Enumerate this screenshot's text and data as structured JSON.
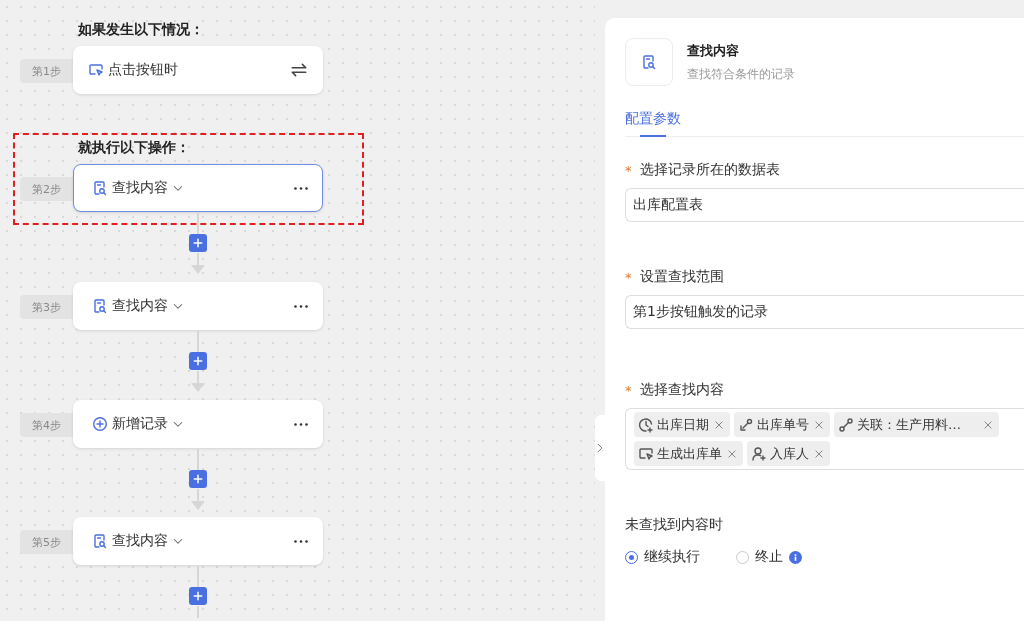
{
  "flow": {
    "trigger_heading": "如果发生以下情况：",
    "action_heading": "就执行以下操作：",
    "steps": [
      {
        "kind": "click",
        "step_label": "第1步",
        "title": "点击按钮时",
        "selected": false
      },
      {
        "kind": "find",
        "step_label": "第2步",
        "title": "查找内容",
        "selected": true
      },
      {
        "kind": "find",
        "step_label": "第3步",
        "title": "查找内容",
        "selected": false
      },
      {
        "kind": "add",
        "step_label": "第4步",
        "title": "新增记录",
        "selected": false
      },
      {
        "kind": "find",
        "step_label": "第5步",
        "title": "查找内容",
        "selected": false
      }
    ]
  },
  "panel": {
    "title": "查找内容",
    "subtitle": "查找符合条件的记录",
    "tabs": [
      {
        "label": "配置参数",
        "selected": true
      }
    ],
    "fields": [
      {
        "kind": "input",
        "required_mark": "*",
        "label": "选择记录所在的数据表",
        "value": "出库配置表"
      },
      {
        "kind": "input",
        "required_mark": "*",
        "label": "设置查找范围",
        "value": "第1步按钮触发的记录"
      },
      {
        "kind": "tags",
        "required_mark": "*",
        "label": "选择查找内容",
        "tags": [
          {
            "kind": "date",
            "label": "出库日期"
          },
          {
            "kind": "link",
            "label": "出库单号"
          },
          {
            "kind": "relation",
            "label": "关联：生产用料…"
          },
          {
            "kind": "click",
            "label": "生成出库单"
          },
          {
            "kind": "user",
            "label": "入库人"
          }
        ]
      }
    ],
    "not_found": {
      "label": "未查找到内容时",
      "options": [
        {
          "label": "继续执行",
          "selected": true,
          "info": false
        },
        {
          "label": "终止",
          "selected": false,
          "info": true
        }
      ]
    }
  }
}
